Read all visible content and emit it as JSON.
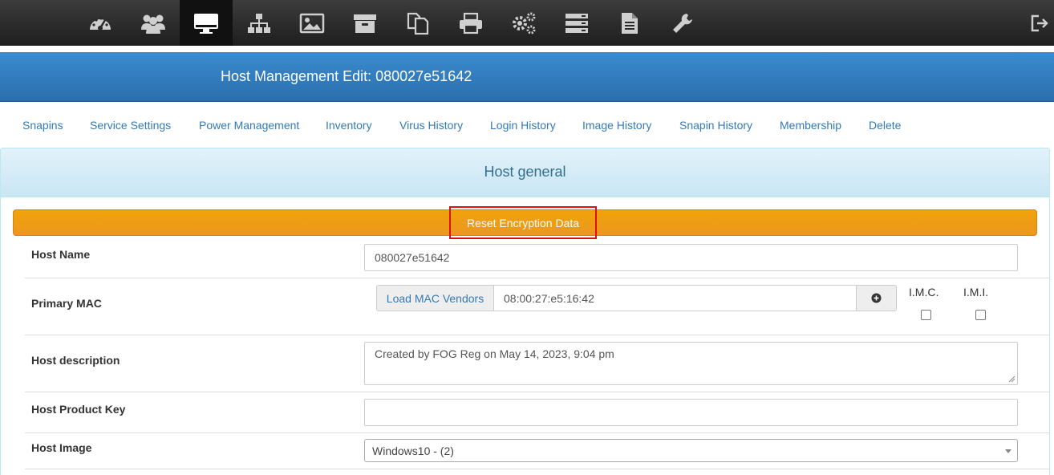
{
  "nav": {
    "icons": [
      "dashboard-icon",
      "users-icon",
      "monitor-icon",
      "network-icon",
      "image-icon",
      "archive-icon",
      "copy-icon",
      "printer-icon",
      "gears-icon",
      "server-icon",
      "file-icon",
      "wrench-icon",
      "logout-icon"
    ],
    "active": "monitor-icon"
  },
  "header": {
    "title": "Host Management Edit: 080027e51642"
  },
  "tabs": [
    "Snapins",
    "Service Settings",
    "Power Management",
    "Inventory",
    "Virus History",
    "Login History",
    "Image History",
    "Snapin History",
    "Membership",
    "Delete"
  ],
  "panel": {
    "title": "Host general"
  },
  "reset_button": "Reset Encryption Data",
  "form": {
    "host_name": {
      "label": "Host Name",
      "value": "080027e51642"
    },
    "primary_mac": {
      "label": "Primary MAC",
      "load_vendors": "Load MAC Vendors",
      "value": "08:00:27:e5:16:42",
      "imc_label": "I.M.C.",
      "imi_label": "I.M.I."
    },
    "description": {
      "label": "Host description",
      "value": "Created by FOG Reg on May 14, 2023, 9:04 pm"
    },
    "product_key": {
      "label": "Host Product Key",
      "value": ""
    },
    "image": {
      "label": "Host Image",
      "selected": "Windows10 - (2)"
    }
  },
  "colors": {
    "nav_bg": "#2a2a2a",
    "banner": "#2f7abf",
    "link": "#337ab7",
    "panel_head": "#d9edf7",
    "orange": "#ec971f",
    "highlight": "#e01010"
  }
}
